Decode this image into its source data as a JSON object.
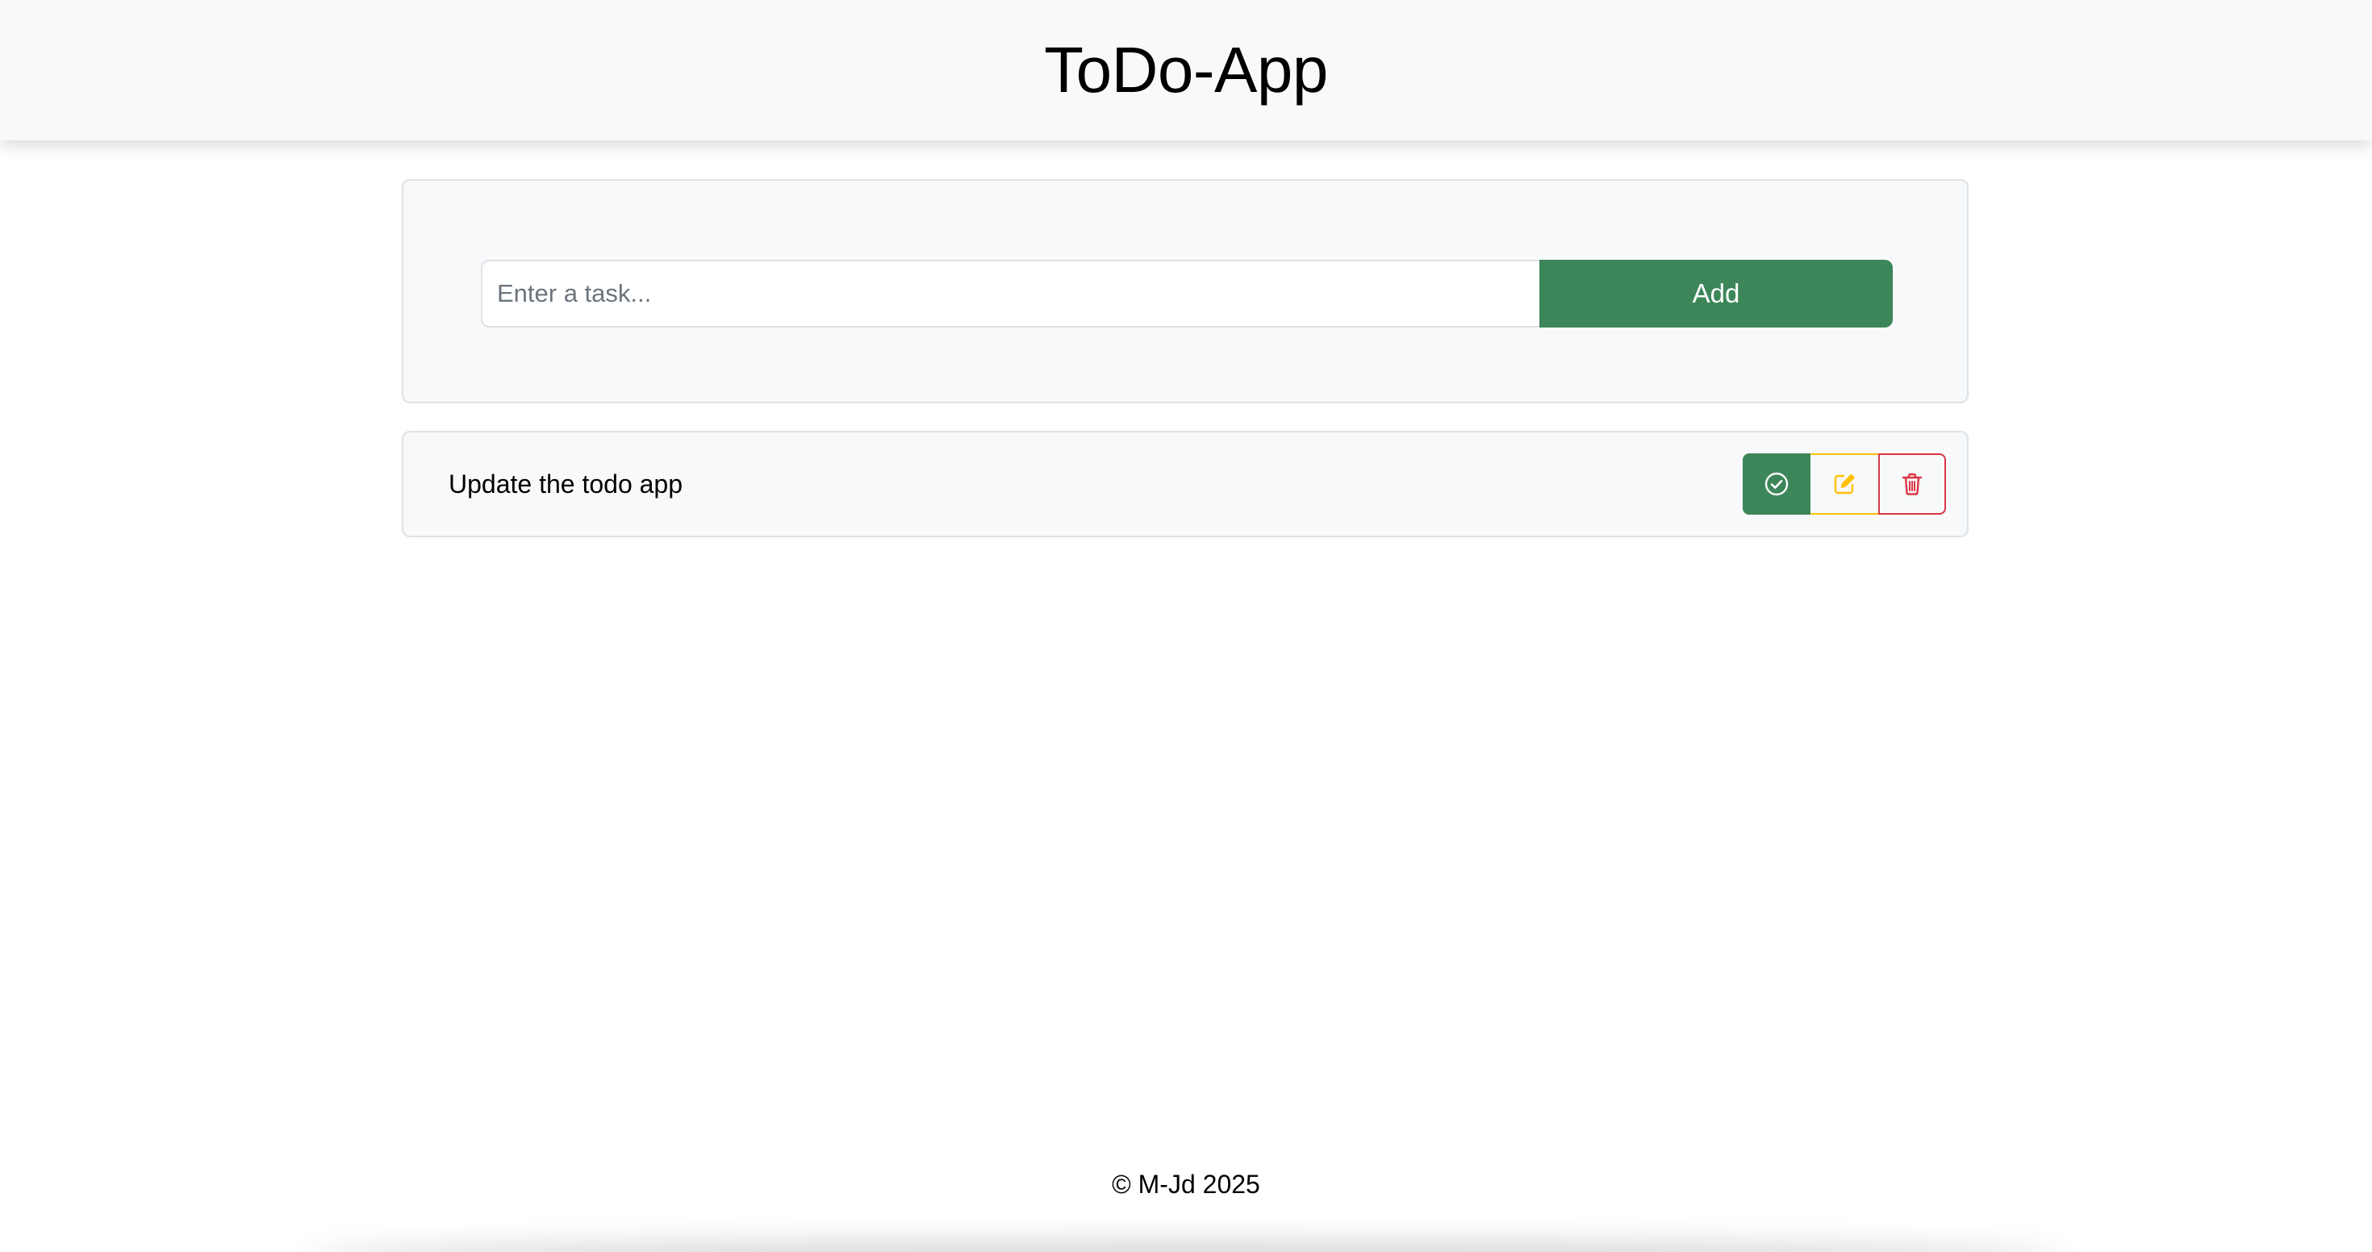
{
  "header": {
    "title": "ToDo-App"
  },
  "task_form": {
    "input_value": "",
    "input_placeholder": "Enter a task...",
    "add_label": "Add"
  },
  "tasks": [
    {
      "text": "Update the todo app",
      "actions": [
        {
          "name": "complete",
          "icon": "check-circle-icon",
          "color": "#3d8659"
        },
        {
          "name": "edit",
          "icon": "pencil-square-icon",
          "color": "#ffc107"
        },
        {
          "name": "delete",
          "icon": "trash-icon",
          "color": "#dc3545"
        }
      ]
    }
  ],
  "footer": {
    "copyright": "© M-Jd 2025"
  },
  "colors": {
    "header_bg": "#f8f9fa",
    "card_bg": "#f8f9fa",
    "border": "#dee2e6",
    "success": "#3d8659",
    "warning": "#ffc107",
    "danger": "#dc3545"
  }
}
